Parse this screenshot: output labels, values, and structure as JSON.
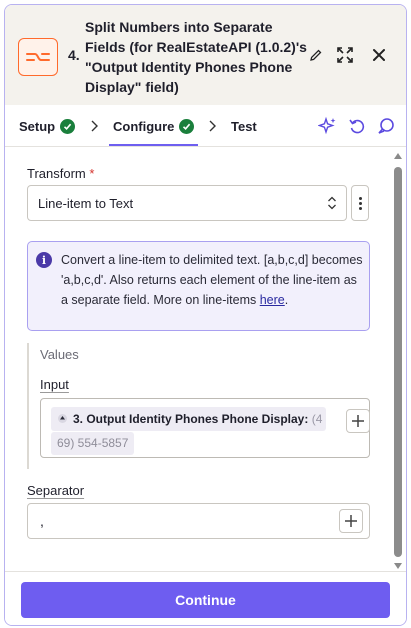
{
  "header": {
    "step_number": "4.",
    "title": "Split Numbers into Separate Fields (for RealEstateAPI (1.0.2)'s \"Output Identity Phones Phone Display\" field)",
    "app_icon": "formatter-icon",
    "accent_color": "#ff6a2c"
  },
  "tabs": [
    {
      "label": "Setup",
      "status": "complete"
    },
    {
      "label": "Configure",
      "status": "complete",
      "active": true
    },
    {
      "label": "Test"
    }
  ],
  "form": {
    "transform_label": "Transform",
    "transform_required": "*",
    "transform_value": "Line-item to Text",
    "info_text": "Convert a line-item to delimited text. [a,b,c,d] becomes 'a,b,c,d'. Also returns each element of the line-item as a separate field. More on line-items ",
    "info_link": "here",
    "info_end": ".",
    "values_heading": "Values",
    "input_label": "Input",
    "input_pill_label": "3. Output Identity Phones Phone Display:",
    "input_pill_value_start": "(4",
    "input_pill_value_rest": "69) 554-5857",
    "separator_label": "Separator",
    "separator_value": ","
  },
  "footer": {
    "continue_label": "Continue",
    "button_color": "#6e5df0"
  }
}
